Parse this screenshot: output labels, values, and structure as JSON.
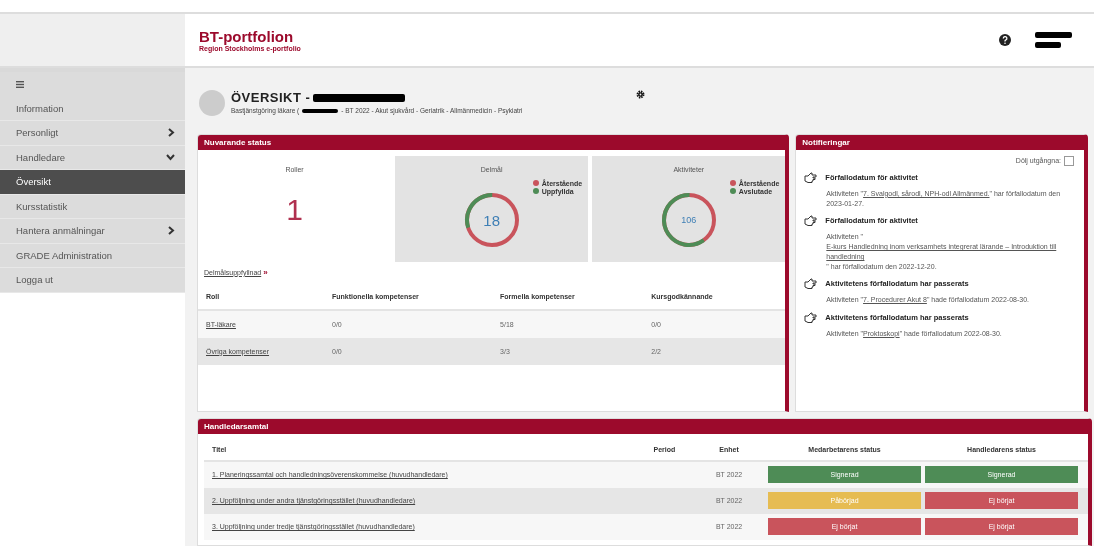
{
  "logo": {
    "title": "BT-portfolion",
    "subtitle": "Region Stockholms e-portfolio"
  },
  "sidebar": {
    "items": [
      {
        "kind": "link",
        "label": "Information",
        "selected": false
      },
      {
        "kind": "group",
        "label": "Personligt",
        "selected": false,
        "expanded": false
      },
      {
        "kind": "group",
        "label": "Handledare",
        "selected": false,
        "expanded": true
      },
      {
        "kind": "link",
        "label": "Översikt",
        "selected": true
      },
      {
        "kind": "link",
        "label": "Kursstatistik",
        "selected": false
      },
      {
        "kind": "group",
        "label": "Hantera anmälningar",
        "selected": false,
        "expanded": false
      },
      {
        "kind": "link",
        "label": "GRADE Administration",
        "selected": false
      },
      {
        "kind": "link",
        "label": "Logga ut",
        "selected": false
      }
    ]
  },
  "overview": {
    "title": "ÖVERSIKT -",
    "subtitle_start": "Bastjänstgöring läkare (",
    "subtitle_end": "- BT 2022 - Akut sjukvård - Geriatrik - Allmänmedicin - Psykiatri"
  },
  "status": {
    "title": "Nuvarande status",
    "tiles": [
      {
        "kind": "number",
        "label": "Roller",
        "value": "1"
      },
      {
        "kind": "donut",
        "label": "Delmål",
        "value": "18",
        "legend": [
          {
            "label": "Återstående",
            "color": "#c9545c"
          },
          {
            "label": "Uppfyllda",
            "color": "#4e8c56"
          }
        ]
      },
      {
        "kind": "donut",
        "label": "Aktiviteter",
        "value": "106",
        "legend": [
          {
            "label": "Återstående",
            "color": "#c9545c"
          },
          {
            "label": "Avslutade",
            "color": "#4e8c56"
          }
        ]
      }
    ],
    "link": "Delmålsuppfyllnad",
    "link_icon": "»",
    "columns": [
      "Roll",
      "Funktionella kompetenser",
      "Formella kompetenser",
      "Kursgodkännande"
    ],
    "rows": [
      [
        "BT-läkare",
        "0/0",
        "5/18",
        "0/0"
      ],
      [
        "Övriga kompetenser",
        "0/0",
        "3/3",
        "2/2"
      ]
    ]
  },
  "notifications": {
    "title": "Notifieringar",
    "toggle_label": "Dölj utgångna:",
    "toggle_checked": false,
    "items": [
      {
        "title": "Förfallodatum för aktivitet",
        "before": "Aktiviteten \"",
        "link": "7. Svalgodl, sårodl, NPH-odl Allmänmed.",
        "after": "\" har förfallodatum den 2023-01-27."
      },
      {
        "title": "Förfallodatum för aktivitet",
        "before": "Aktiviteten \"",
        "link": "E-kurs Handledning inom verksamhets integrerat lärande – Introduktion till handledning",
        "after": "\" har förfallodatum den 2022-12-20."
      },
      {
        "title": "Aktivitetens förfallodatum har passerats",
        "before": "Aktiviteten \"",
        "link": "7. Procedurer Akut 8",
        "after": "\" hade förfallodatum 2022-08-30."
      },
      {
        "title": "Aktivitetens förfallodatum har passerats",
        "before": "Aktiviteten \"",
        "link": "Proktoskopi",
        "after": "\" hade förfallodatum 2022-08-30."
      }
    ]
  },
  "meetings": {
    "title": "Handledarsamtal",
    "columns": [
      "Titel",
      "Period",
      "Enhet",
      "Medarbetarens status",
      "Handledarens status"
    ],
    "rows": [
      {
        "title": "1. Planeringssamtal och handledningsöverenskommelse (huvudhandledare)",
        "period": "",
        "unit": "BT 2022",
        "employee": {
          "label": "Signerad",
          "color": "#4e8c56"
        },
        "supervisor": {
          "label": "Signerad",
          "color": "#4e8c56"
        }
      },
      {
        "title": "2. Uppföljning under andra tjänstgöringsstället (huvudhandledare)",
        "period": "",
        "unit": "BT 2022",
        "employee": {
          "label": "Påbörjad",
          "color": "#e6bc52"
        },
        "supervisor": {
          "label": "Ej börjat",
          "color": "#c9545c"
        }
      },
      {
        "title": "3. Uppföljning under tredje tjänstgöringsstället (huvudhandledare)",
        "period": "",
        "unit": "BT 2022",
        "employee": {
          "label": "Ej börjat",
          "color": "#c9545c"
        },
        "supervisor": {
          "label": "Ej börjat",
          "color": "#c9545c"
        }
      }
    ]
  }
}
